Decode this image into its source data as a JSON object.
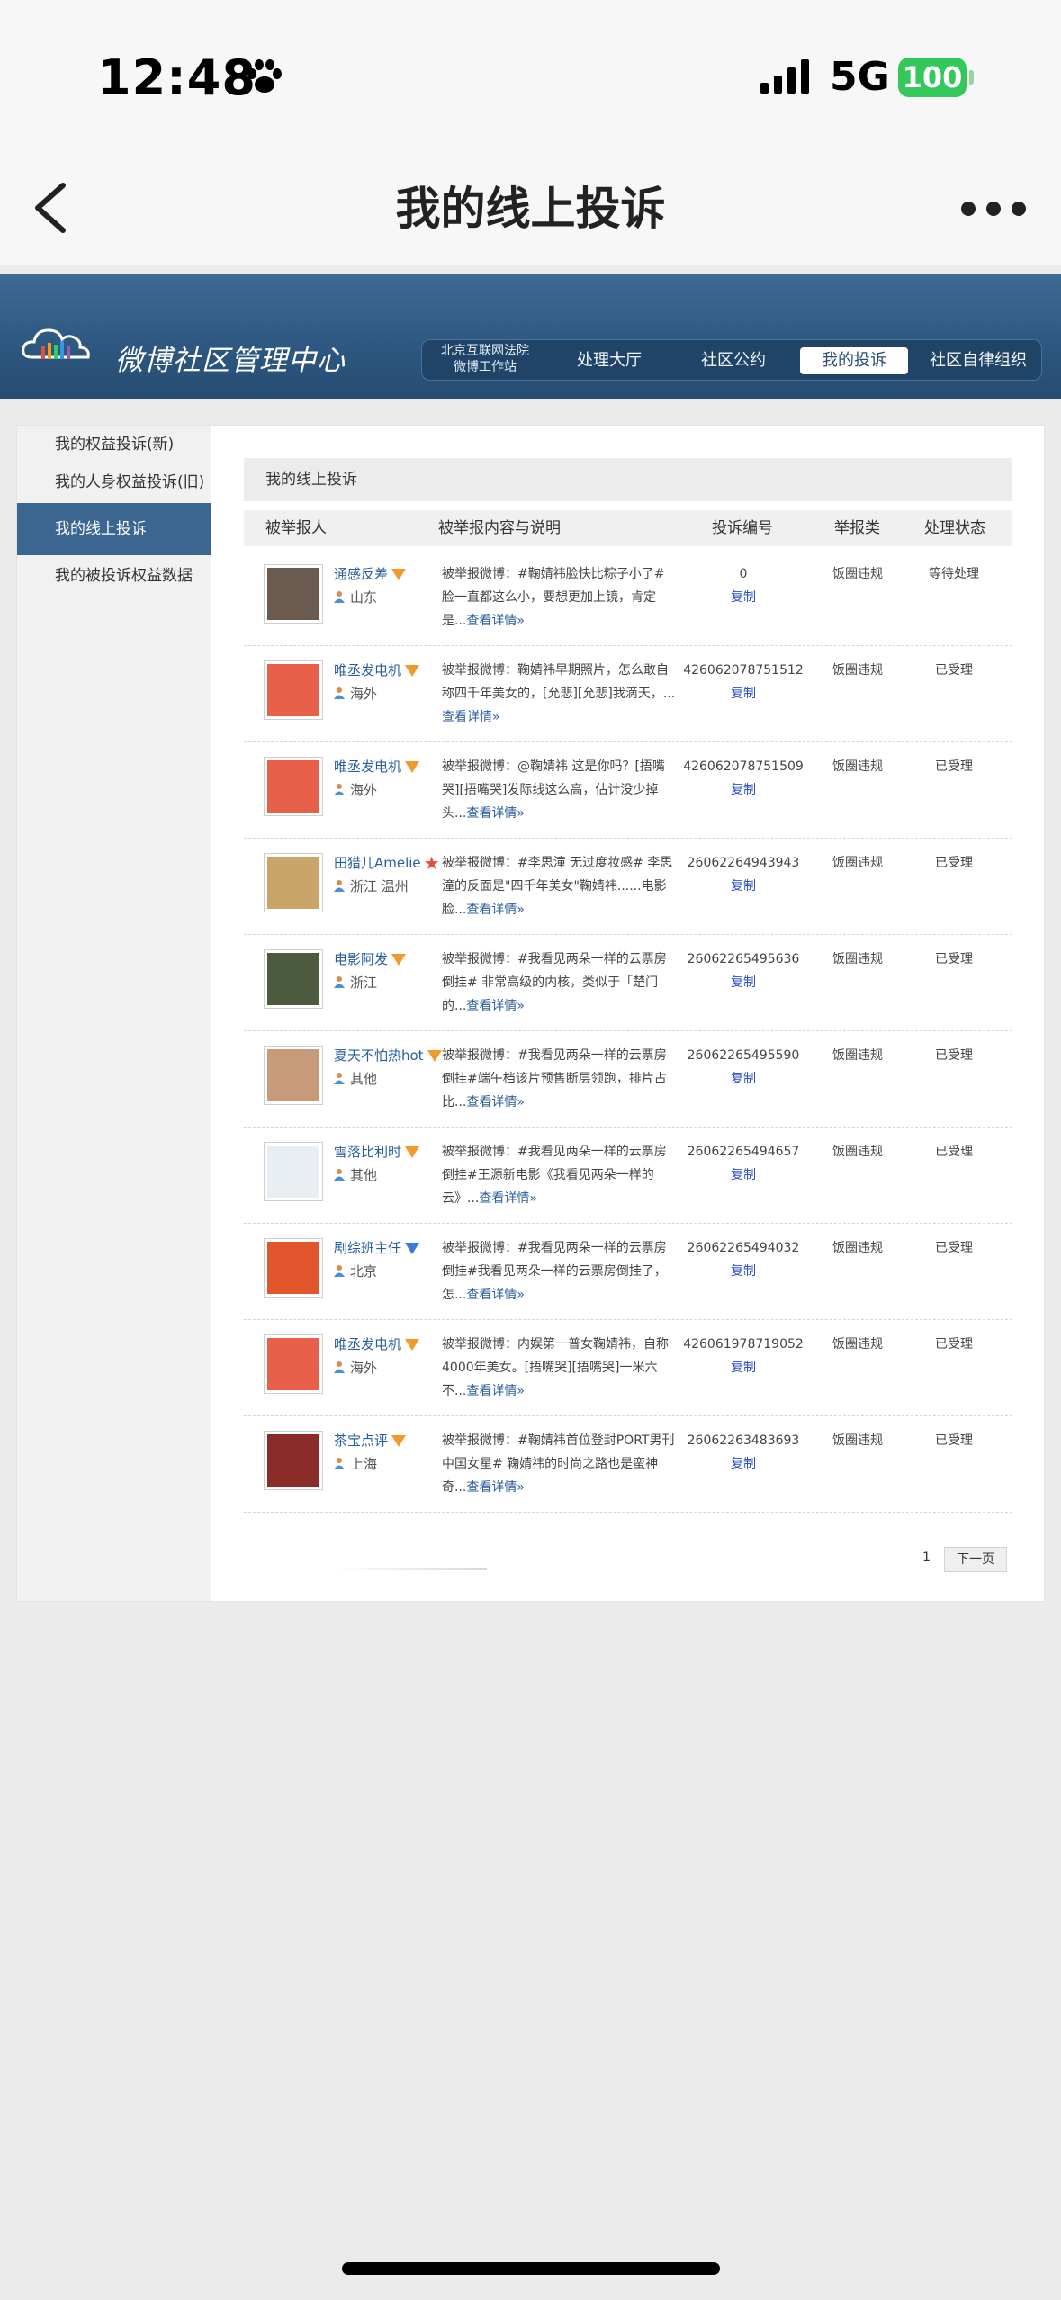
{
  "status_bar": {
    "time": "12:48",
    "network": "5G",
    "battery": "100"
  },
  "navbar": {
    "title": "我的线上投诉"
  },
  "header": {
    "logo_text": "微博社区管理中心",
    "court_line1": "北京互联网法院",
    "court_line2": "微博工作站",
    "nav": [
      "处理大厅",
      "社区公约",
      "我的投诉",
      "社区自律组织"
    ],
    "active_nav": "我的投诉"
  },
  "sidebar": {
    "items": [
      "我的权益投诉(新)",
      "我的人身权益投诉(旧)",
      "我的线上投诉",
      "我的被投诉权益数据"
    ],
    "active": "我的线上投诉"
  },
  "main": {
    "title": "我的线上投诉",
    "columns": [
      "被举报人",
      "被举报内容与说明",
      "投诉编号",
      "举报类",
      "处理状态"
    ],
    "copy_label": "复制",
    "more_label": "查看详情»",
    "rows": [
      {
        "name": "通感反差",
        "badge": "orange",
        "location": "山东",
        "desc": "被举报微博：#鞠婧祎脸快比粽子小了#脸一直都这么小，要想更加上镜，肯定是...",
        "complaint_no": "0",
        "type": "饭圈违规",
        "status": "等待处理"
      },
      {
        "name": "唯丞发电机",
        "badge": "orange",
        "location": "海外",
        "desc": "被举报微博：鞠婧祎早期照片，怎么敢自称四千年美女的，[允悲][允悲]我滴天，...",
        "complaint_no": "426062078751512",
        "type": "饭圈违规",
        "status": "已受理"
      },
      {
        "name": "唯丞发电机",
        "badge": "orange",
        "location": "海外",
        "desc": "被举报微博：@鞠婧祎 这是你吗？[捂嘴哭][捂嘴哭]发际线这么高，估计没少掉头...",
        "complaint_no": "426062078751509",
        "type": "饭圈违规",
        "status": "已受理"
      },
      {
        "name": "田猎儿Amelie",
        "badge": "star",
        "location": "浙江 温州",
        "desc": "被举报微博：#李思潼 无过度妆感# 李思潼的反面是\"四千年美女\"鞠婧祎......电影脸...",
        "complaint_no": "26062264943943",
        "type": "饭圈违规",
        "status": "已受理"
      },
      {
        "name": "电影阿发",
        "badge": "orange",
        "location": "浙江",
        "desc": "被举报微博：#我看见两朵一样的云票房倒挂# 非常高级的内核，类似于「楚门的...",
        "complaint_no": "26062265495636",
        "type": "饭圈违规",
        "status": "已受理"
      },
      {
        "name": "夏天不怕热hot",
        "badge": "orange",
        "location": "其他",
        "desc": "被举报微博：#我看见两朵一样的云票房倒挂#端午档该片预售断层领跑，排片占比...",
        "complaint_no": "26062265495590",
        "type": "饭圈违规",
        "status": "已受理"
      },
      {
        "name": "雪落比利时",
        "badge": "orange",
        "location": "其他",
        "desc": "被举报微博：#我看见两朵一样的云票房倒挂#王源新电影《我看见两朵一样的云》...",
        "complaint_no": "26062265494657",
        "type": "饭圈违规",
        "status": "已受理"
      },
      {
        "name": "剧综班主任",
        "badge": "blue",
        "location": "北京",
        "desc": "被举报微博：#我看见两朵一样的云票房倒挂#我看见两朵一样的云票房倒挂了，怎...",
        "complaint_no": "26062265494032",
        "type": "饭圈违规",
        "status": "已受理"
      },
      {
        "name": "唯丞发电机",
        "badge": "orange",
        "location": "海外",
        "desc": "被举报微博：内娱第一普女鞠婧祎，自称4000年美女。[捂嘴哭][捂嘴哭]一米六不...",
        "complaint_no": "426061978719052",
        "type": "饭圈违规",
        "status": "已受理"
      },
      {
        "name": "茶宝点评",
        "badge": "orange",
        "location": "上海",
        "desc": "被举报微博：#鞠婧祎首位登封PORT男刊中国女星# 鞠婧祎的时尚之路也是蛮神奇...",
        "complaint_no": "26062263483693",
        "type": "饭圈违规",
        "status": "已受理"
      }
    ]
  },
  "pager": {
    "page": "1",
    "next": "下一页"
  }
}
